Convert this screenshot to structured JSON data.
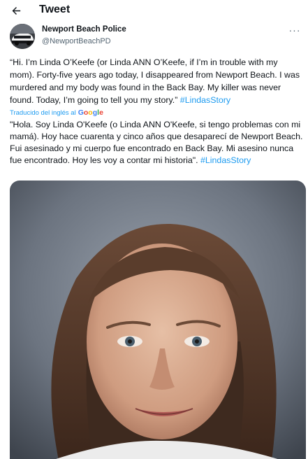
{
  "header": {
    "title": "Tweet",
    "back_icon": "arrow-left-icon"
  },
  "author": {
    "name": "Newport Beach Police",
    "handle": "@NewportBeachPD",
    "more_icon": "more-options-icon"
  },
  "tweet": {
    "text": "“Hi.  I’m Linda O’Keefe (or Linda ANN O’Keefe, if I’m in trouble with my mom).  Forty-five years ago today, I disappeared from Newport Beach.  I was murdered and my body was found in the Back Bay.   My killer was never found.  Today, I’m going to tell you my story.” ",
    "hashtag": "#LindasStory"
  },
  "translation": {
    "label": "Traducido del inglés al",
    "provider": "Google",
    "text": "\"Hola. Soy Linda O'Keefe (o Linda ANN O'Keefe, si tengo problemas con mi mamá). Hoy hace cuarenta y cinco años que desaparecí de Newport Beach. Fui asesinado y mi cuerpo fue encontrado en Back Bay. Mi asesino nunca fue encontrado. Hoy les voy a contar mi historia\". ",
    "hashtag": "#LindasStory"
  },
  "colors": {
    "link": "#1d9bf0",
    "text": "#0f1419",
    "secondary": "#536471"
  }
}
